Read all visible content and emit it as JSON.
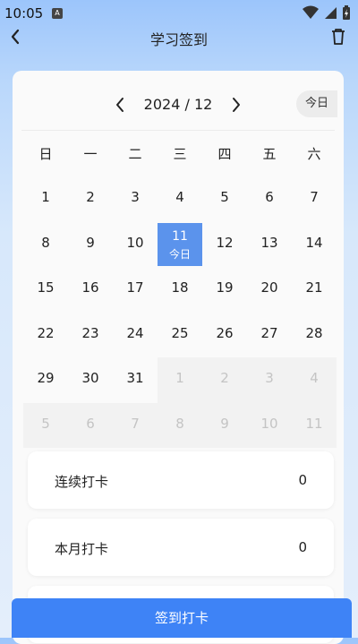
{
  "status_bar": {
    "time": "10:05",
    "notif_icon": "A"
  },
  "nav": {
    "title": "学习签到"
  },
  "calendar": {
    "month_label": "2024 / 12",
    "today_button": "今日",
    "weekdays": [
      "日",
      "一",
      "二",
      "三",
      "四",
      "五",
      "六"
    ],
    "weeks": [
      [
        {
          "d": "1",
          "cur": true
        },
        {
          "d": "2",
          "cur": true
        },
        {
          "d": "3",
          "cur": true
        },
        {
          "d": "4",
          "cur": true
        },
        {
          "d": "5",
          "cur": true
        },
        {
          "d": "6",
          "cur": true
        },
        {
          "d": "7",
          "cur": true
        }
      ],
      [
        {
          "d": "8",
          "cur": true
        },
        {
          "d": "9",
          "cur": true
        },
        {
          "d": "10",
          "cur": true
        },
        {
          "d": "11",
          "cur": true,
          "today": true,
          "sub": "今日"
        },
        {
          "d": "12",
          "cur": true
        },
        {
          "d": "13",
          "cur": true
        },
        {
          "d": "14",
          "cur": true
        }
      ],
      [
        {
          "d": "15",
          "cur": true
        },
        {
          "d": "16",
          "cur": true
        },
        {
          "d": "17",
          "cur": true
        },
        {
          "d": "18",
          "cur": true
        },
        {
          "d": "19",
          "cur": true
        },
        {
          "d": "20",
          "cur": true
        },
        {
          "d": "21",
          "cur": true
        }
      ],
      [
        {
          "d": "22",
          "cur": true
        },
        {
          "d": "23",
          "cur": true
        },
        {
          "d": "24",
          "cur": true
        },
        {
          "d": "25",
          "cur": true
        },
        {
          "d": "26",
          "cur": true
        },
        {
          "d": "27",
          "cur": true
        },
        {
          "d": "28",
          "cur": true
        }
      ],
      [
        {
          "d": "29",
          "cur": true
        },
        {
          "d": "30",
          "cur": true
        },
        {
          "d": "31",
          "cur": true
        },
        {
          "d": "1",
          "cur": false
        },
        {
          "d": "2",
          "cur": false
        },
        {
          "d": "3",
          "cur": false
        },
        {
          "d": "4",
          "cur": false
        }
      ],
      [
        {
          "d": "5",
          "cur": false
        },
        {
          "d": "6",
          "cur": false
        },
        {
          "d": "7",
          "cur": false
        },
        {
          "d": "8",
          "cur": false
        },
        {
          "d": "9",
          "cur": false
        },
        {
          "d": "10",
          "cur": false
        },
        {
          "d": "11",
          "cur": false
        }
      ]
    ]
  },
  "stats": {
    "streak_label": "连续打卡",
    "streak_value": "0",
    "month_label": "本月打卡",
    "month_value": "0"
  },
  "actions": {
    "sign_in_label": "签到打卡"
  },
  "colors": {
    "accent": "#3e83f6",
    "today_cell": "#5b93ec"
  }
}
